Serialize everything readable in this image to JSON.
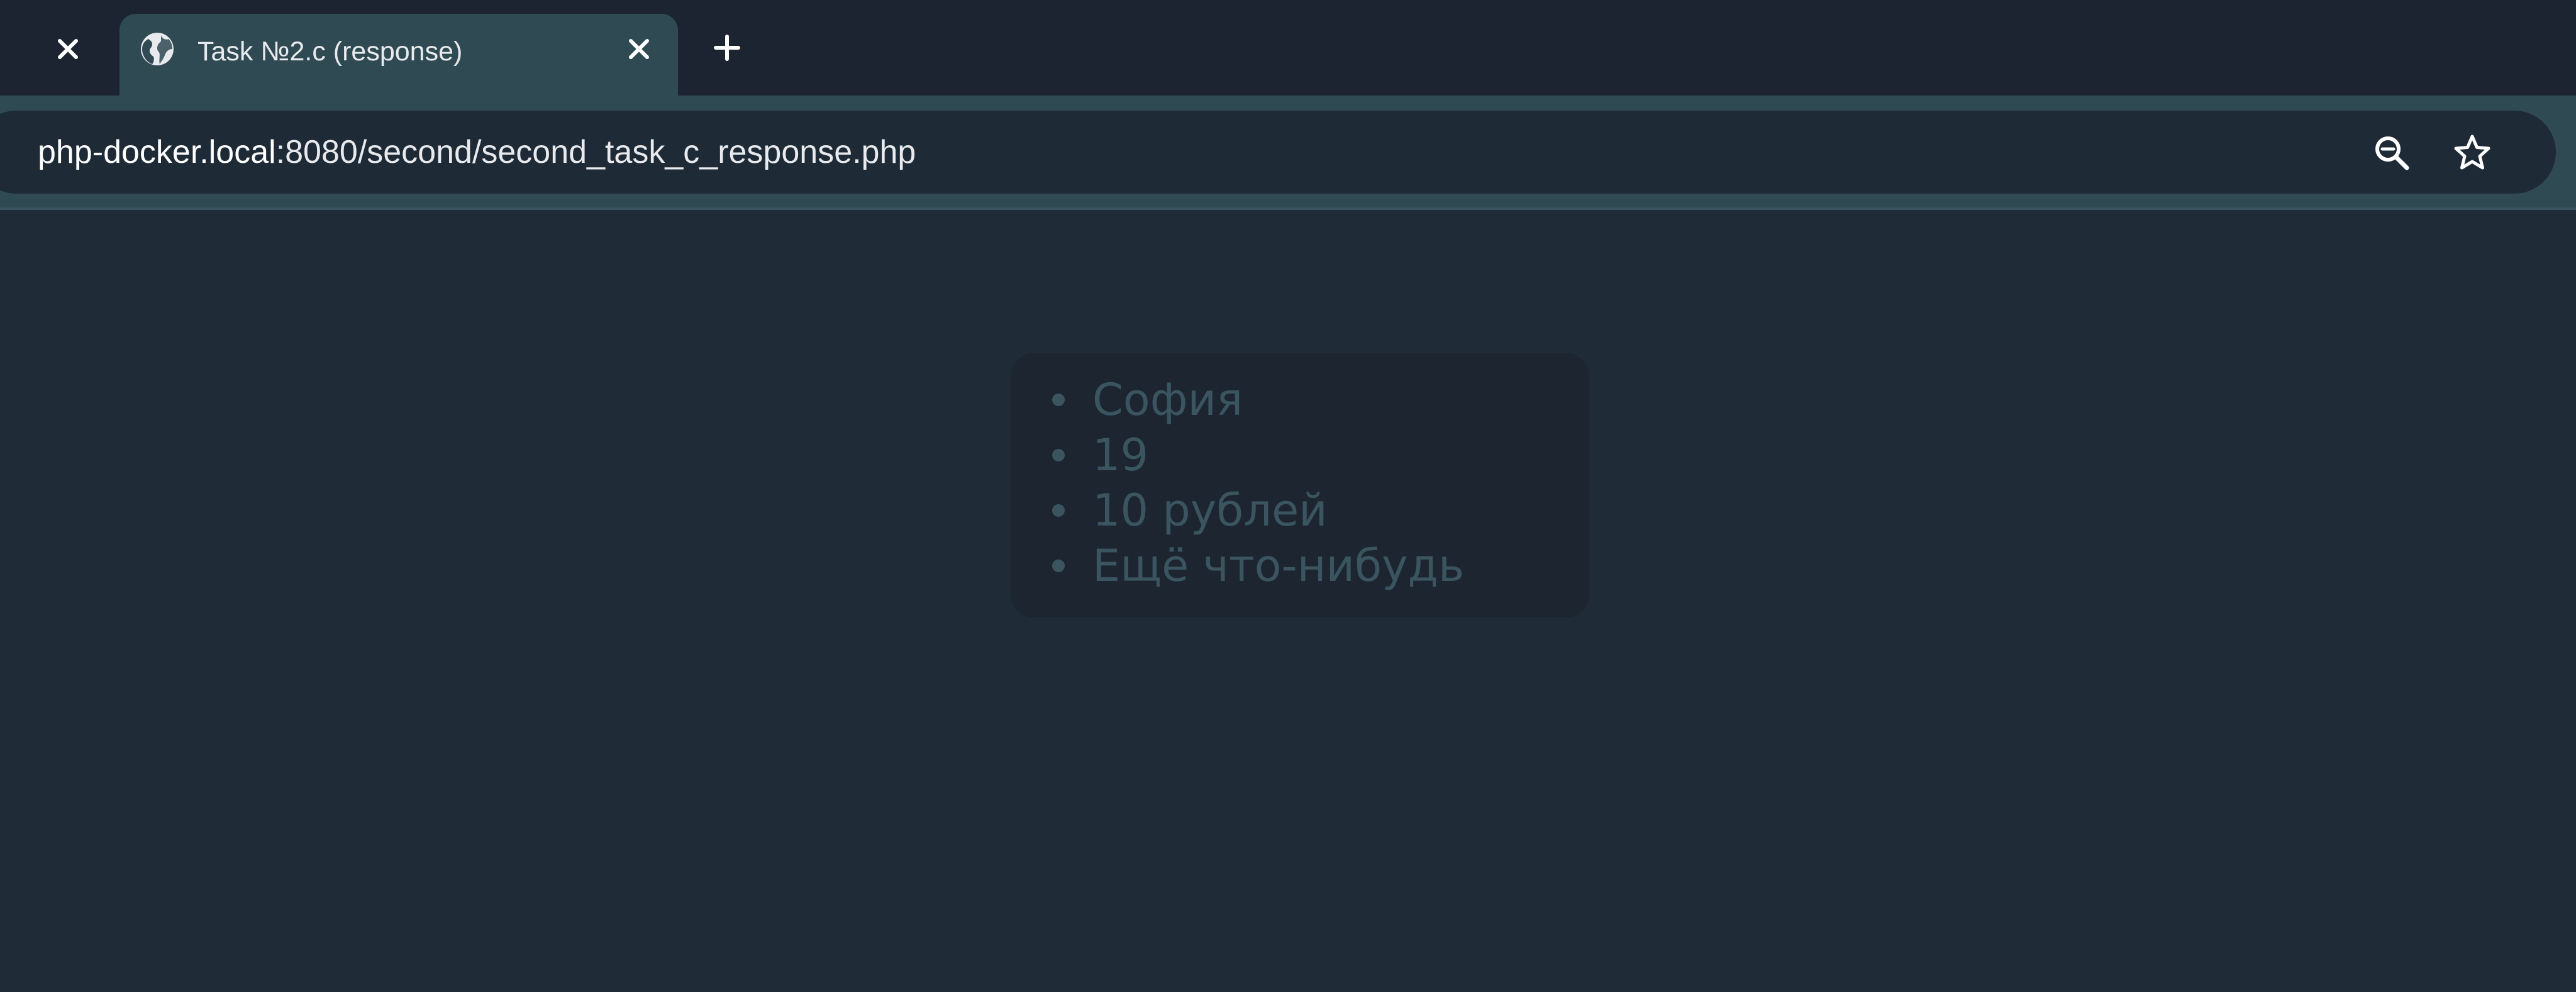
{
  "browser": {
    "tab": {
      "title": "Task №2.c (response)",
      "favicon": "globe-icon"
    },
    "prev_tab_close": "close-icon",
    "new_tab": "plus-icon",
    "address_bar": {
      "host": "php-docker.local",
      "rest": ":8080/second/second_task_c_response.php",
      "zoom_icon": "zoom-out-icon",
      "bookmark_icon": "star-icon"
    },
    "colors": {
      "tabstrip": "#1c2431",
      "active_tab": "#2f4a52",
      "omnibox": "#1e2a36",
      "page_background": "#1f2b36"
    }
  },
  "page": {
    "list": [
      "София",
      "19",
      "10 рублей",
      "Ещё что-нибудь"
    ],
    "colors": {
      "card": "#1c2530",
      "text": "#3a5560"
    }
  }
}
